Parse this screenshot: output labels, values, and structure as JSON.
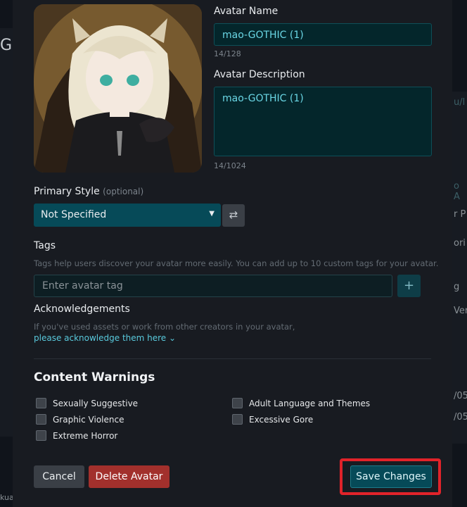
{
  "avatar_name": {
    "label": "Avatar Name",
    "value": "mao-GOTHIC  (1)",
    "counter": "14/128"
  },
  "avatar_description": {
    "label": "Avatar Description",
    "value": "mao-GOTHIC  (1)",
    "counter": "14/1024"
  },
  "primary_style": {
    "label": "Primary Style",
    "optional": "(optional)",
    "selected": "Not Specified"
  },
  "tags": {
    "label": "Tags",
    "help": "Tags help users discover your avatar more easily. You can add up to 10 custom tags for your avatar.",
    "placeholder": "Enter avatar tag",
    "add": "+"
  },
  "acknowledgements": {
    "label": "Acknowledgements",
    "help": "If you've used assets or work from other creators in your avatar,",
    "link": "please acknowledge them here ⌄"
  },
  "content_warnings": {
    "title": "Content Warnings",
    "items": [
      "Sexually Suggestive",
      "Adult Language and Themes",
      "Graphic Violence",
      "Excessive Gore",
      "Extreme Horror"
    ]
  },
  "buttons": {
    "cancel": "Cancel",
    "delete": "Delete Avatar",
    "save": "Save Changes"
  },
  "icons": {
    "swap": "⇄",
    "chevron": "▼"
  },
  "background": {
    "left_letter": "G",
    "right_fragments": [
      "u/l",
      "o A",
      "r P",
      "ori",
      "g",
      "Ver",
      "/05",
      "/05",
      "kua"
    ]
  },
  "colors": {
    "accent": "#064a58",
    "danger": "#a2302c",
    "highlight": "#e1232a"
  }
}
